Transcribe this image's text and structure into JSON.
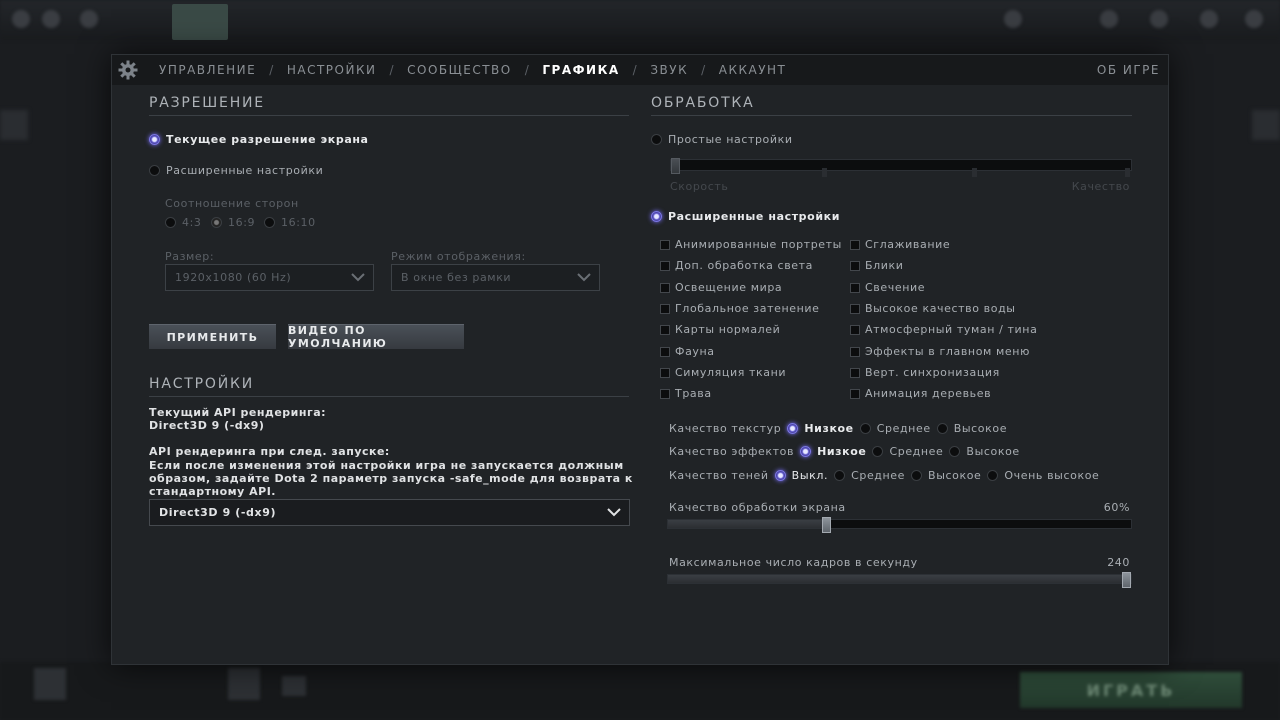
{
  "tabs": {
    "items": [
      "УПРАВЛЕНИЕ",
      "НАСТРОЙКИ",
      "СООБЩЕСТВО",
      "ГРАФИКА",
      "ЗВУК",
      "АККАУНТ"
    ],
    "active_index": 3,
    "separator": "/",
    "about": "ОБ ИГРЕ"
  },
  "resolution": {
    "title": "РАЗРЕШЕНИЕ",
    "current_label": "Текущее разрешение экрана",
    "current_selected": true,
    "advanced_label": "Расширенные настройки",
    "aspect_label": "Соотношение сторон",
    "aspect_options": [
      "4:3",
      "16:9",
      "16:10"
    ],
    "aspect_selected": "16:9",
    "size_label": "Размер:",
    "size_value": "1920x1080 (60 Hz)",
    "mode_label": "Режим отображения:",
    "mode_value": "В окне без рамки",
    "apply_button": "ПРИМЕНИТЬ",
    "default_button": "ВИДЕО ПО УМОЛЧАНИЮ"
  },
  "settings": {
    "title": "НАСТРОЙКИ",
    "api_current_label": "Текущий API рендеринга:",
    "api_current_value": "Direct3D 9 (-dx9)",
    "api_next_label": "API рендеринга при след. запуске:",
    "api_note_1": "Если после изменения этой настройки игра не запускается должным",
    "api_note_2": "образом, задайте Dota 2 параметр запуска -safe_mode для возврата к",
    "api_note_3": "стандартному API.",
    "api_select_value": "Direct3D 9 (-dx9)"
  },
  "processing": {
    "title": "ОБРАБОТКА",
    "simple_label": "Простые настройки",
    "simple_slider_left": "Скорость",
    "simple_slider_right": "Качество",
    "simple_slider_value": 0,
    "advanced_label": "Расширенные настройки",
    "advanced_selected": true,
    "checkboxes_left": [
      "Анимированные портреты",
      "Доп. обработка света",
      "Освещение мира",
      "Глобальное затенение",
      "Карты нормалей",
      "Фауна",
      "Симуляция ткани",
      "Трава"
    ],
    "checkboxes_right": [
      "Сглаживание",
      "Блики",
      "Свечение",
      "Высокое качество воды",
      "Атмосферный туман / тина",
      "Эффекты в главном меню",
      "Верт. синхронизация",
      "Анимация деревьев"
    ],
    "texture_label": "Качество текстур",
    "texture_options": [
      "Низкое",
      "Среднее",
      "Высокое"
    ],
    "texture_selected": "Низкое",
    "effects_label": "Качество эффектов",
    "effects_options": [
      "Низкое",
      "Среднее",
      "Высокое"
    ],
    "effects_selected": "Низкое",
    "shadows_label": "Качество теней",
    "shadows_options": [
      "Выкл.",
      "Среднее",
      "Высокое",
      "Очень высокое"
    ],
    "shadows_selected": "Выкл.",
    "screen_quality_label": "Качество обработки экрана",
    "screen_quality_value": "60%",
    "screen_quality_fraction": 0.34,
    "fps_label": "Максимальное число кадров в секунду",
    "fps_value": "240",
    "fps_fraction": 1.0
  },
  "background": {
    "play_button": "ИГРАТЬ"
  },
  "colors": {
    "panel_bg": "#202326",
    "accent_radio": "#7a72ff",
    "tab_active": "#ffffff"
  }
}
